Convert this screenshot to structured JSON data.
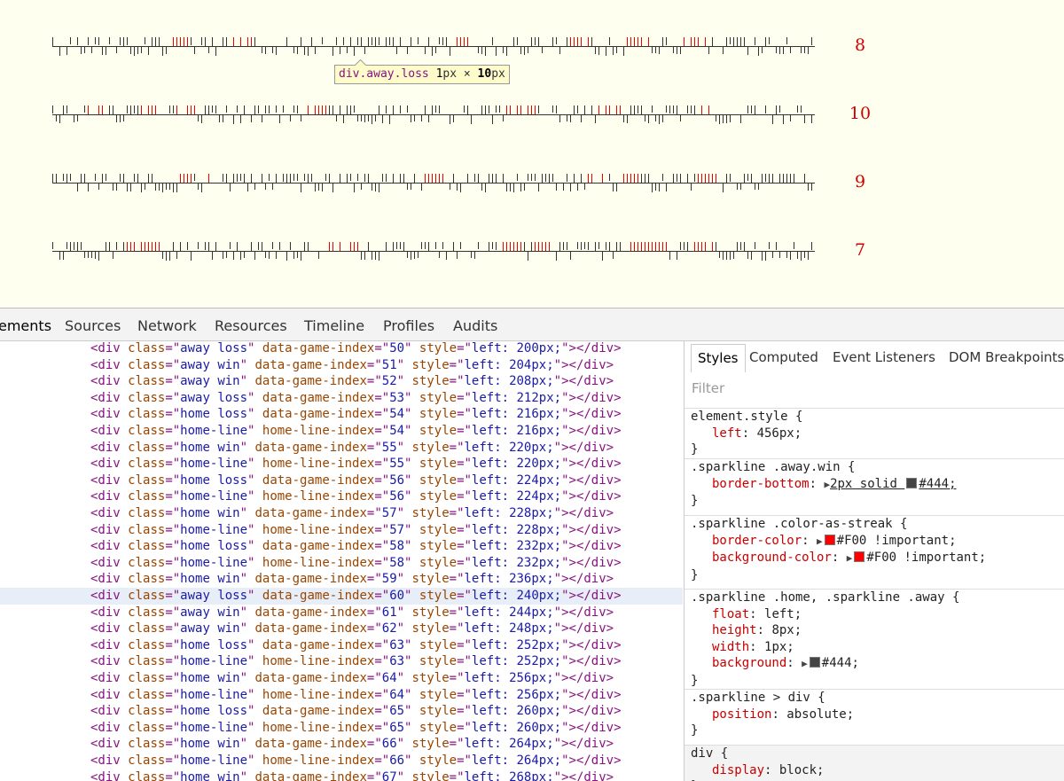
{
  "preview": {
    "scores": [
      "8",
      "10",
      "9",
      "7"
    ],
    "colors": {
      "tick": "#333333",
      "streak": "#ee0000",
      "score": "#d00000",
      "background": "#fffff0"
    },
    "tooltip": {
      "tag": "div.away.loss",
      "width_num": "1",
      "width_unit": "px",
      "times": "×",
      "height_num": "10",
      "height_unit": "px"
    }
  },
  "devtools": {
    "tabs": [
      "ements",
      "Sources",
      "Network",
      "Resources",
      "Timeline",
      "Profiles",
      "Audits"
    ],
    "elements": [
      {
        "cls": "away loss",
        "attr": "data-game-index",
        "idx": "50",
        "left": "200px;"
      },
      {
        "cls": "away win",
        "attr": "data-game-index",
        "idx": "51",
        "left": "204px;"
      },
      {
        "cls": "away win",
        "attr": "data-game-index",
        "idx": "52",
        "left": "208px;"
      },
      {
        "cls": "away loss",
        "attr": "data-game-index",
        "idx": "53",
        "left": "212px;"
      },
      {
        "cls": "home loss",
        "attr": "data-game-index",
        "idx": "54",
        "left": "216px;"
      },
      {
        "cls": "home-line",
        "attr": "home-line-index",
        "idx": "54",
        "left": "216px;"
      },
      {
        "cls": "home win",
        "attr": "data-game-index",
        "idx": "55",
        "left": "220px;"
      },
      {
        "cls": "home-line",
        "attr": "home-line-index",
        "idx": "55",
        "left": "220px;"
      },
      {
        "cls": "home loss",
        "attr": "data-game-index",
        "idx": "56",
        "left": "224px;"
      },
      {
        "cls": "home-line",
        "attr": "home-line-index",
        "idx": "56",
        "left": "224px;"
      },
      {
        "cls": "home win",
        "attr": "data-game-index",
        "idx": "57",
        "left": "228px;"
      },
      {
        "cls": "home-line",
        "attr": "home-line-index",
        "idx": "57",
        "left": "228px;"
      },
      {
        "cls": "home loss",
        "attr": "data-game-index",
        "idx": "58",
        "left": "232px;"
      },
      {
        "cls": "home-line",
        "attr": "home-line-index",
        "idx": "58",
        "left": "232px;"
      },
      {
        "cls": "home win",
        "attr": "data-game-index",
        "idx": "59",
        "left": "236px;"
      },
      {
        "cls": "away loss",
        "attr": "data-game-index",
        "idx": "60",
        "left": "240px;",
        "selected": true
      },
      {
        "cls": "away win",
        "attr": "data-game-index",
        "idx": "61",
        "left": "244px;"
      },
      {
        "cls": "away win",
        "attr": "data-game-index",
        "idx": "62",
        "left": "248px;"
      },
      {
        "cls": "home loss",
        "attr": "data-game-index",
        "idx": "63",
        "left": "252px;"
      },
      {
        "cls": "home-line",
        "attr": "home-line-index",
        "idx": "63",
        "left": "252px;"
      },
      {
        "cls": "home win",
        "attr": "data-game-index",
        "idx": "64",
        "left": "256px;"
      },
      {
        "cls": "home-line",
        "attr": "home-line-index",
        "idx": "64",
        "left": "256px;"
      },
      {
        "cls": "home loss",
        "attr": "data-game-index",
        "idx": "65",
        "left": "260px;"
      },
      {
        "cls": "home-line",
        "attr": "home-line-index",
        "idx": "65",
        "left": "260px;"
      },
      {
        "cls": "home win",
        "attr": "data-game-index",
        "idx": "66",
        "left": "264px;"
      },
      {
        "cls": "home-line",
        "attr": "home-line-index",
        "idx": "66",
        "left": "264px;"
      },
      {
        "cls": "home win",
        "attr": "data-game-index",
        "idx": "67",
        "left": "268px;"
      }
    ],
    "sidebar": {
      "tabs": [
        "Styles",
        "Computed",
        "Event Listeners",
        "DOM Breakpoints"
      ],
      "filter_placeholder": "Filter",
      "rules": [
        {
          "selector": "element.style {",
          "decls": [
            {
              "prop": "left",
              "value": "456px;"
            }
          ]
        },
        {
          "selector": ".sparkline .away.win {",
          "decls": [
            {
              "prop": "border-bottom",
              "value": "2px solid ",
              "swatch": "#444444",
              "swatch_text": "#444;"
            }
          ]
        },
        {
          "selector": ".sparkline .color-as-streak {",
          "decls": [
            {
              "prop": "border-color",
              "swatch": "#ff0000",
              "swatch_text": "#F00",
              "value": " !important;"
            },
            {
              "prop": "background-color",
              "swatch": "#ff0000",
              "swatch_text": "#F00",
              "value": " !important;"
            }
          ]
        },
        {
          "selector": ".sparkline .home, .sparkline .away {",
          "decls": [
            {
              "prop": "float",
              "value": "left;"
            },
            {
              "prop": "height",
              "value": "8px;"
            },
            {
              "prop": "width",
              "value": "1px;"
            },
            {
              "prop": "background",
              "swatch": "#444444",
              "swatch_text": "#444;"
            }
          ]
        },
        {
          "selector": ".sparkline > div {",
          "decls": [
            {
              "prop": "position",
              "value": "absolute;"
            }
          ]
        },
        {
          "selector": "div {",
          "decls": [
            {
              "prop": "display",
              "value": "block;"
            }
          ]
        }
      ]
    }
  }
}
